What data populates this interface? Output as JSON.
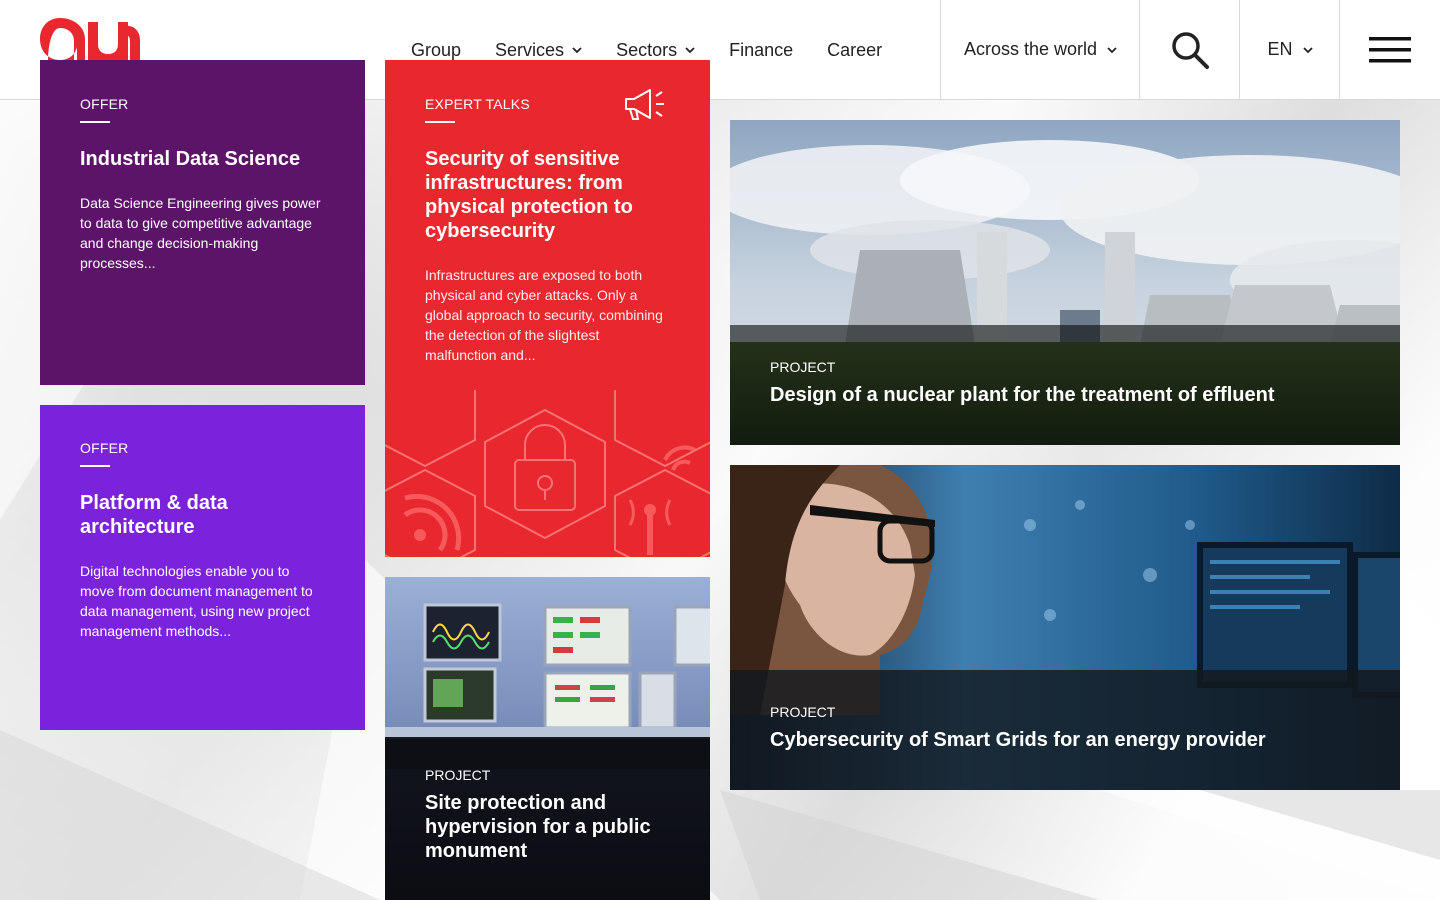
{
  "header": {
    "nav": [
      {
        "label": "Group",
        "dropdown": false
      },
      {
        "label": "Services",
        "dropdown": true
      },
      {
        "label": "Sectors",
        "dropdown": true
      },
      {
        "label": "Finance",
        "dropdown": false
      },
      {
        "label": "Career",
        "dropdown": false
      }
    ],
    "world_label": "Across the world",
    "lang_label": "EN"
  },
  "colors": {
    "brand_red": "#e8282e",
    "purple_dark": "#5b1467",
    "purple_bright": "#7a22dc"
  },
  "cards": {
    "industrial": {
      "tag": "OFFER",
      "title": "Industrial Data Science",
      "desc": "Data Science Engineering gives power to data to give competitive advantage and change decision-making processes..."
    },
    "platform": {
      "tag": "OFFER",
      "title": "Platform & data architecture",
      "desc": "Digital technologies enable you to move from document management to data management, using new project management methods..."
    },
    "security": {
      "tag": "EXPERT TALKS",
      "title": "Security of sensitive infrastructures: from physical protection to cybersecurity",
      "desc": "Infrastructures are exposed to both physical and cyber attacks. Only a global approach to security, combining the detection of the slightest malfunction and..."
    }
  },
  "projects": {
    "monument": {
      "tag": "PROJECT",
      "title": "Site protection and hypervision for a public monument"
    },
    "nuclear": {
      "tag": "PROJECT",
      "title": "Design of a nuclear plant for the treatment of effluent"
    },
    "smartgrid": {
      "tag": "PROJECT",
      "title": "Cybersecurity of Smart Grids for an energy provider"
    }
  }
}
